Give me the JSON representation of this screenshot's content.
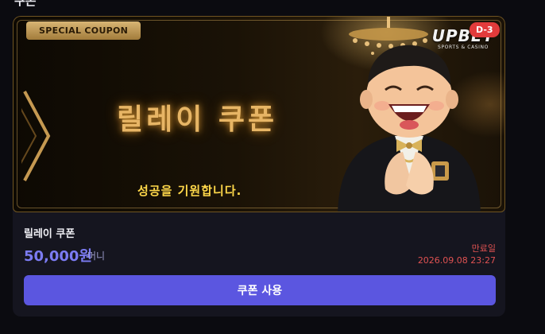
{
  "page": {
    "header": "쿠폰"
  },
  "banner": {
    "badge": "SPECIAL COUPON",
    "title": "릴레이 쿠폰",
    "subtitle": "성공을 기원합니다.",
    "logo": {
      "text": "UPBET",
      "sub": "SPORTS & CASINO"
    },
    "dday": "D-3"
  },
  "coupon": {
    "name": "릴레이 쿠폰",
    "amount": "50,000원",
    "unit": "머니",
    "expiry_label": "만료일",
    "expiry_date": "2026.09.08 23:27"
  },
  "actions": {
    "use_label": "쿠폰 사용"
  },
  "colors": {
    "accent": "#5b56e0",
    "amount": "#7b7bf2",
    "expiry": "#e05252",
    "gold": "#e7b565",
    "dday": "#e23b3b"
  },
  "icons": [
    "chevron-right-icon",
    "chandelier-icon",
    "mascot-image",
    "upbet-logo"
  ]
}
